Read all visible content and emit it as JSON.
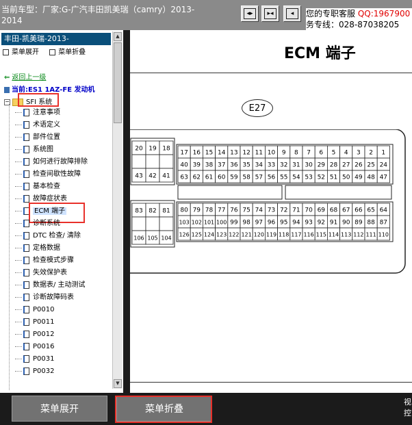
{
  "header": {
    "vehicle_label": "当前车型：厂家:G-广汽丰田凯美瑞（camry）2013-2014",
    "support_line1_prefix": "您的专职客服",
    "support_qq": "QQ:1967900",
    "support_line2": "务专线：028-87038205"
  },
  "toolbar": {
    "btn1_glyph": "◂▸",
    "btn2_glyph": "▸◂",
    "btn3_glyph": "◂"
  },
  "sidebar": {
    "title": "丰田-凯美瑞-2013-",
    "expand_label": "菜单展开",
    "collapse_label": "菜单折叠",
    "back_label": "返回上一级",
    "current_label": "当前:ES1 1AZ-FE 发动机",
    "folder_label": "SFI 系统",
    "items": [
      {
        "label": "注意事项"
      },
      {
        "label": "术语定义"
      },
      {
        "label": "部件位置"
      },
      {
        "label": "系统图"
      },
      {
        "label": "如何进行故障排除"
      },
      {
        "label": "检查间歇性故障"
      },
      {
        "label": "基本检查"
      },
      {
        "label": "故障症状表"
      },
      {
        "label": "ECM 端子"
      },
      {
        "label": "诊断系统"
      },
      {
        "label": "DTC 检查/ 清除"
      },
      {
        "label": "定格数据"
      },
      {
        "label": "检查模式步骤"
      },
      {
        "label": "失效保护表"
      },
      {
        "label": "数据表/ 主动测试"
      },
      {
        "label": "诊断故障码表"
      },
      {
        "label": "P0010"
      },
      {
        "label": "P0011"
      },
      {
        "label": "P0012"
      },
      {
        "label": "P0016"
      },
      {
        "label": "P0031"
      },
      {
        "label": "P0032"
      }
    ]
  },
  "main": {
    "title": "ECM 端子",
    "connector_label": "E27",
    "left_top_pins": [
      [
        "20",
        "19",
        "18"
      ],
      [
        "",
        "",
        ""
      ],
      [
        "43",
        "42",
        "41"
      ]
    ],
    "left_bottom_pins": [
      [
        "83",
        "82",
        "81"
      ],
      [
        "",
        "",
        ""
      ],
      [
        "106",
        "105",
        "104"
      ]
    ],
    "right_top_pins": [
      [
        "17",
        "16",
        "15",
        "14",
        "13",
        "12",
        "11",
        "10",
        "9",
        "8",
        "7",
        "6",
        "5",
        "4",
        "3",
        "2",
        "1"
      ],
      [
        "40",
        "39",
        "38",
        "37",
        "36",
        "35",
        "34",
        "33",
        "32",
        "31",
        "30",
        "29",
        "28",
        "27",
        "26",
        "25",
        "24"
      ],
      [
        "63",
        "62",
        "61",
        "60",
        "59",
        "58",
        "57",
        "56",
        "55",
        "54",
        "53",
        "52",
        "51",
        "50",
        "49",
        "48",
        "47"
      ]
    ],
    "right_bottom_pins": [
      [
        "80",
        "79",
        "78",
        "77",
        "76",
        "75",
        "74",
        "73",
        "72",
        "71",
        "70",
        "69",
        "68",
        "67",
        "66",
        "65",
        "64"
      ],
      [
        "103",
        "102",
        "101",
        "100",
        "99",
        "98",
        "97",
        "96",
        "95",
        "94",
        "93",
        "92",
        "91",
        "90",
        "89",
        "88",
        "87"
      ],
      [
        "126",
        "125",
        "124",
        "123",
        "122",
        "121",
        "120",
        "119",
        "118",
        "117",
        "116",
        "115",
        "114",
        "113",
        "112",
        "111",
        "110"
      ]
    ]
  },
  "footer": {
    "expand_button": "菜单展开",
    "collapse_button": "菜单折叠",
    "side_text": "视控"
  },
  "colors": {
    "highlight_box": "#e8302a",
    "sidebar_header": "#0a4f7a",
    "bottom_button": "#727272"
  }
}
